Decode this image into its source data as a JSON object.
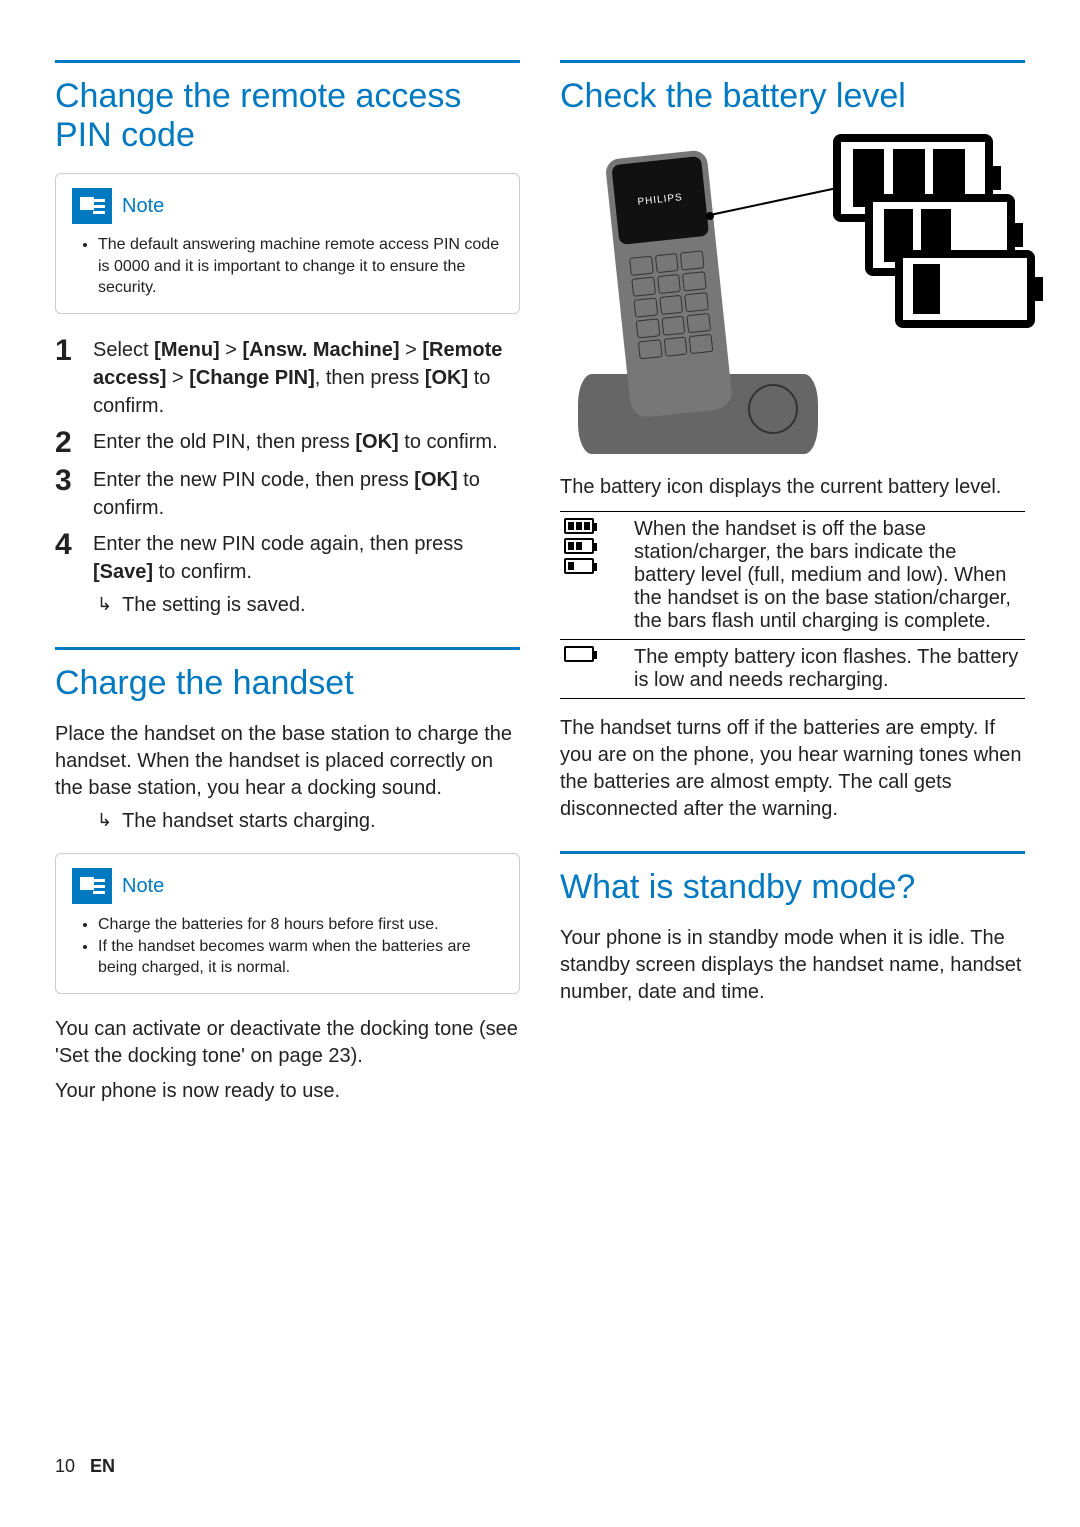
{
  "left": {
    "section1": {
      "title": "Change the remote access PIN code",
      "note_label": "Note",
      "note_items": [
        "The default answering machine remote access PIN code is 0000 and it is important to change it to ensure the security."
      ],
      "steps": [
        {
          "num": "1",
          "pre": "Select ",
          "seq": [
            "[Menu]",
            " > ",
            "[Answ. Machine]",
            " > ",
            "[Remote access]",
            " > ",
            "[Change PIN]"
          ],
          "mid": ", then press ",
          "key": "[OK]",
          "post": " to confirm."
        },
        {
          "num": "2",
          "pre": "Enter the old PIN, then press ",
          "key": "[OK]",
          "post": " to confirm."
        },
        {
          "num": "3",
          "pre": "Enter the new PIN code, then press ",
          "key": "[OK]",
          "post": " to confirm."
        },
        {
          "num": "4",
          "pre": "Enter the new PIN code again, then press ",
          "key": "[Save]",
          "post": " to confirm."
        }
      ],
      "result": "The setting is saved."
    },
    "section2": {
      "title": "Charge the handset",
      "para": "Place the handset on the base station to charge the handset. When the handset is placed correctly on the base station, you hear a docking sound.",
      "result": "The handset starts charging.",
      "note_label": "Note",
      "note_items": [
        "Charge the batteries for 8 hours before first use.",
        "If the handset becomes warm when the batteries are being charged, it is normal."
      ],
      "closing1": "You can activate or deactivate the docking tone (see 'Set the docking tone' on page 23).",
      "closing2": "Your phone is now ready to use."
    }
  },
  "right": {
    "section1": {
      "title": "Check the battery level",
      "brand": "PHILIPS",
      "caption": "The battery icon displays the current battery level.",
      "row1": "When the handset is off the base station/charger, the bars indicate the battery level (full, medium and low). When the handset is on the base station/charger, the bars flash until charging is complete.",
      "row2": "The empty battery icon flashes. The battery is low and needs recharging.",
      "after": "The handset turns off if the batteries are empty. If you are on the phone, you hear warning tones when the batteries are almost empty. The call gets disconnected after the warning."
    },
    "section2": {
      "title": "What is standby mode?",
      "para": "Your phone is in standby mode when it is idle. The standby screen displays the handset name, handset number, date and time."
    }
  },
  "footer": {
    "page": "10",
    "lang": "EN"
  }
}
